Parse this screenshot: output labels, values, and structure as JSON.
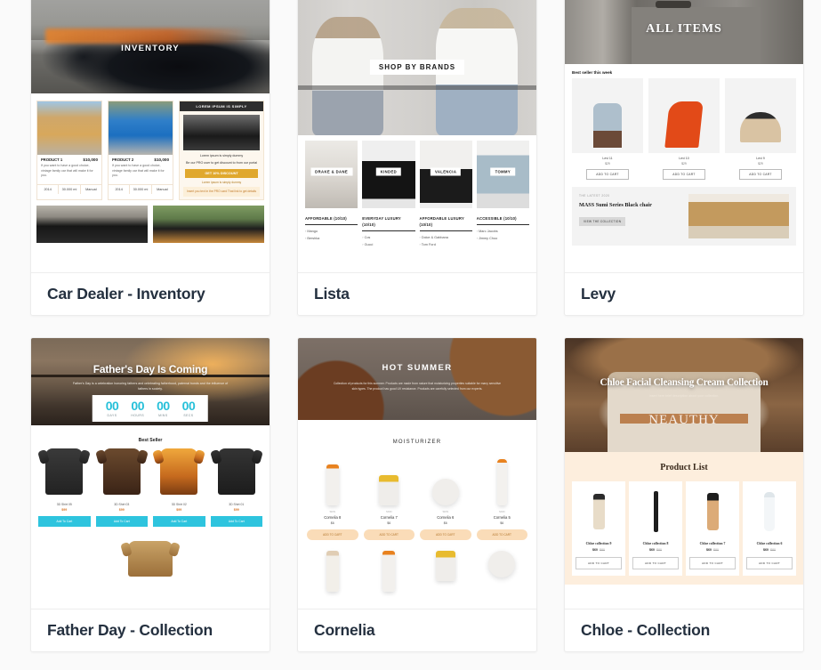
{
  "page": {
    "background_color": "#fafafa",
    "card_background": "#ffffff",
    "title_color": "#24303f"
  },
  "cards": [
    {
      "title": "Car Dealer - Inventory",
      "hero_label": "INVENTORY",
      "products": [
        {
          "name": "PRODUCT 1",
          "price": "$10,000",
          "desc": "If you want to have a good choice, vintage family car that will make it for you.",
          "specs": [
            "2014",
            "30.000 mi",
            "Manual"
          ]
        },
        {
          "name": "PRODUCT 2",
          "price": "$10,000",
          "desc": "If you want to have a good choice, vintage family car that will make it for you.",
          "specs": [
            "2014",
            "30.000 mi",
            "Manual"
          ]
        }
      ],
      "sidebar": {
        "heading": "LOREM IPSUM IS SIMPLY",
        "text_1": "Lorem ipsum is simply dummy",
        "text_2": "Be our PRO user to get discount to from our portal",
        "button": "GET 10% DISCOUNT",
        "note": "Lorem ipsum is simply dummy",
        "box": "Insert you text in the PRO card That link to get details"
      }
    },
    {
      "title": "Lista",
      "hero_label": "SHOP BY BRANDS",
      "brands": [
        "DRAKE & DANE",
        "KINDED",
        "VALENCIA",
        "TOMMY"
      ],
      "columns": [
        {
          "heading": "AFFORDABLE (10/10)",
          "items": [
            "Mango",
            "Bershka"
          ]
        },
        {
          "heading": "EVERYDAY LUXURY (10/10)",
          "items": [
            "Cos",
            "Gucci"
          ]
        },
        {
          "heading": "AFFORDABLE LUXURY (10/10)",
          "items": [
            "Dolce & Gabbana",
            "Tom Ford"
          ]
        },
        {
          "heading": "ACCESSIBLE (10/10)",
          "items": [
            "Marc Jacobs",
            "Jimmy Choo"
          ]
        }
      ]
    },
    {
      "title": "Levy",
      "hero_label": "ALL ITEMS",
      "section_heading": "Best seller this week",
      "products": [
        {
          "name": "Levi 11",
          "price": "$29",
          "button": "ADD TO CART"
        },
        {
          "name": "Levi 10",
          "price": "$29",
          "button": "ADD TO CART"
        },
        {
          "name": "Levi 9",
          "price": "$29",
          "button": "ADD TO CART"
        }
      ],
      "banner": {
        "eyebrow": "THE LATEST 2020",
        "title": "MASS Sumi Series Black chair",
        "button": "VIEW THE COLLECTION"
      }
    },
    {
      "title": "Father Day - Collection",
      "hero_title": "Father's Day Is Coming",
      "hero_desc": "Father's Day is a celebration honoring fathers and celebrating fatherhood, paternal bonds and the influence of fathers in society.",
      "countdown": [
        {
          "value": "00",
          "label": "DAYS"
        },
        {
          "value": "00",
          "label": "HOURS"
        },
        {
          "value": "00",
          "label": "MINS"
        },
        {
          "value": "00",
          "label": "SECS"
        }
      ],
      "section_heading": "Best Seller",
      "products": [
        {
          "name": "3D Shirt 05",
          "price": "$99",
          "button": "Add To Cart"
        },
        {
          "name": "3D Shirt 03",
          "price": "$99",
          "button": "Add To Cart"
        },
        {
          "name": "3D Shirt 02",
          "price": "$99",
          "button": "Add To Cart"
        },
        {
          "name": "3D Shirt 01",
          "price": "$99",
          "button": "Add To Cart"
        }
      ]
    },
    {
      "title": "Cornelia",
      "hero_label": "HOT SUMMER",
      "hero_desc": "Collection of products for this summer. Products are made from nature that moisturizing properties suitable for many sensitive skin types. The product has good UV resistance. Products are carefully selected from our experts.",
      "section_heading": "MOISTURIZER",
      "products": [
        {
          "eyebrow": "SKIN",
          "name": "Cornelia 8",
          "price": "$6",
          "button": "ADD TO CART"
        },
        {
          "eyebrow": "SKIN",
          "name": "Cornelia 7",
          "price": "$6",
          "button": "ADD TO CART"
        },
        {
          "eyebrow": "SKIN",
          "name": "Cornelia 6",
          "price": "$6",
          "button": "ADD TO CART"
        },
        {
          "eyebrow": "SKIN",
          "name": "Cornelia 5",
          "price": "$6",
          "button": "ADD TO CART"
        }
      ]
    },
    {
      "title": "Chloe - Collection",
      "hero_title": "Chloe Facial Cleansing Cream Collection",
      "hero_desc": "Insert here brief description about your collection.",
      "hero_brand": "NEAUTHY",
      "section_heading": "Product List",
      "products": [
        {
          "name": "Chloe collection 9",
          "price": "$60",
          "old_price": "$80",
          "button": "ADD TO CART"
        },
        {
          "name": "Chloe collection 8",
          "price": "$60",
          "old_price": "$80",
          "button": "ADD TO CART"
        },
        {
          "name": "Chloe collection 7",
          "price": "$60",
          "old_price": "$80",
          "button": "ADD TO CART"
        },
        {
          "name": "Chloe collection 6",
          "price": "$60",
          "old_price": "$80",
          "button": "ADD TO CART"
        }
      ]
    }
  ]
}
